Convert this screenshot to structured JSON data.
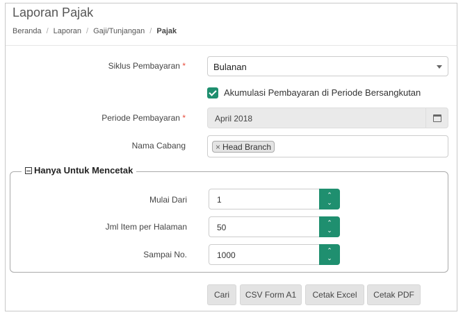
{
  "page": {
    "title": "Laporan Pajak"
  },
  "breadcrumb": [
    "Beranda",
    "Laporan",
    "Gaji/Tunjangan",
    "Pajak"
  ],
  "form": {
    "siklus_label": "Siklus Pembayaran",
    "siklus_value": "Bulanan",
    "akumulasi_label": "Akumulasi Pembayaran di Periode Bersangkutan",
    "akumulasi_checked": true,
    "periode_label": "Periode Pembayaran",
    "periode_value": "April 2018",
    "cabang_label": "Nama Cabang",
    "cabang_tag": "Head Branch",
    "required_mark": "*",
    "tag_remove": "×"
  },
  "print_section": {
    "legend": "Hanya Untuk Mencetak",
    "mulai_label": "Mulai Dari",
    "mulai_value": "1",
    "jml_label": "Jml Item per Halaman",
    "jml_value": "50",
    "sampai_label": "Sampai No.",
    "sampai_value": "1000"
  },
  "buttons": {
    "cari": "Cari",
    "csv": "CSV Form A1",
    "excel": "Cetak Excel",
    "pdf": "Cetak PDF"
  },
  "spinner": {
    "up": "⌃",
    "down": "⌄"
  },
  "colors": {
    "accent": "#1f8f6f"
  }
}
